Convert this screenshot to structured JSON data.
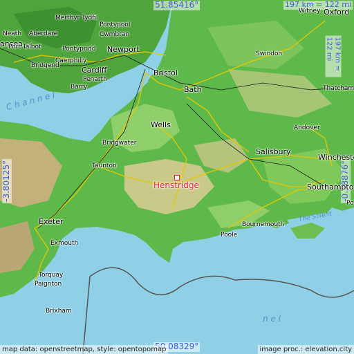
{
  "featured_place": "Henstridge",
  "coords": {
    "top_lat": "51.85416°",
    "bottom_lat": "50.08329°",
    "left_lon": "-3.80125°",
    "right_lon": "-0.38876°"
  },
  "scale": {
    "top": "197 km = 122 mi",
    "right": "197 km = 122 mi"
  },
  "attribution": {
    "left": "map data: openstreetmap, style: opentopomap",
    "right": "image proc.: elevation.city"
  },
  "water_labels": {
    "channel_top": "C h a n n e l",
    "channel_bottom": "n e l",
    "solent": "The Solent"
  },
  "places": {
    "merthyr": "Merthyr Tydfil",
    "neath": "Neath",
    "aberdare": "Aberdare",
    "swansea": "ansea",
    "pontypool": "Pontypool",
    "cwmbran": "Cwmbran",
    "port_talbot": "Port Talbot",
    "pontypridd": "Pontypridd",
    "newport": "Newport",
    "caerphilly": "Caerphilly",
    "bridgend": "Bridgend",
    "cardiff": "Cardiff",
    "penarth": "Penarth",
    "barry": "Barry",
    "bristol": "Bristol",
    "bath": "Bath",
    "swindon": "Swindon",
    "oxford": "Oxford",
    "witney": "Witney",
    "thatcham": "Thatcham",
    "wells": "Wells",
    "andover": "Andover",
    "bridgwater": "Bridgwater",
    "taunton": "Taunton",
    "salisbury": "Salisbury",
    "winchester": "Winchester",
    "southampton": "Southampto",
    "po": "Po",
    "exeter": "Exeter",
    "exmouth": "Exmouth",
    "bournemouth": "Bournemouth",
    "poole": "Poole",
    "torquay": "Torquay",
    "paignton": "Paignton",
    "brixham": "Brixham"
  }
}
